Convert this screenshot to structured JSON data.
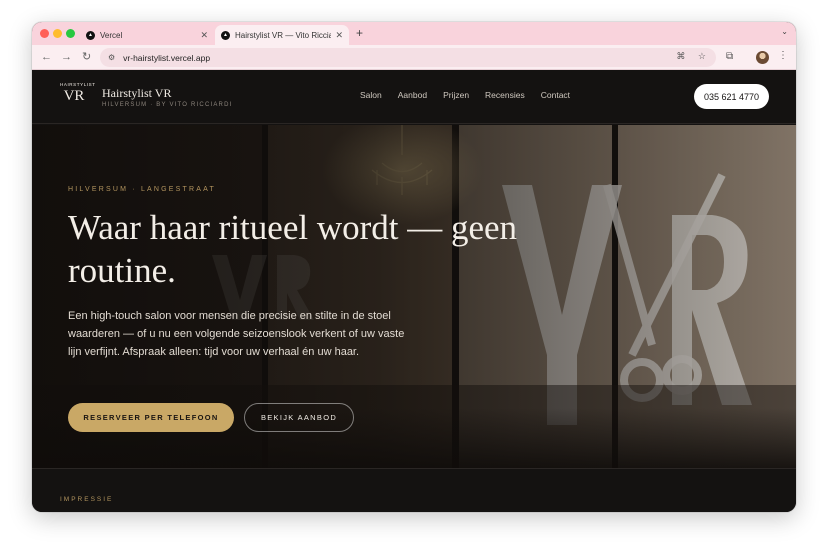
{
  "browser": {
    "tabs": [
      {
        "title": "Vercel",
        "active": false
      },
      {
        "title": "Hairstylist VR — Vito Ricciardi",
        "active": true
      }
    ],
    "url": "vr-hairstylist.vercel.app",
    "new_tab_symbol": "+",
    "colors": {
      "tabstrip": "#f9d3dc",
      "toolbar": "#fbeef1"
    }
  },
  "header": {
    "logo_top": "HAIRSTYLIST",
    "logo_main": "VR",
    "brand_name": "Hairstylist VR",
    "brand_sub": "HILVERSUM · BY VITO RICCIARDI",
    "nav": [
      "Salon",
      "Aanbod",
      "Prijzen",
      "Recensies",
      "Contact"
    ],
    "phone": "035 621 4770"
  },
  "hero": {
    "eyebrow": "HILVERSUM · LANGESTRAAT",
    "headline": "Waar haar ritueel wordt — geen routine.",
    "intro": "Een high-touch salon voor mensen die precisie en stilte in de stoel waarderen — of u nu een volgende seizoenslook verkent of uw vaste lijn verfijnt. Afspraak alleen: tijd voor uw verhaal én uw haar.",
    "primary_cta": "RESERVEER PER TELEFOON",
    "secondary_cta": "BEKIJK AANBOD"
  },
  "section": {
    "label": "IMPRESSIE"
  },
  "colors": {
    "accent": "#c9a866",
    "background": "#141211",
    "text": "#f3eee7"
  }
}
